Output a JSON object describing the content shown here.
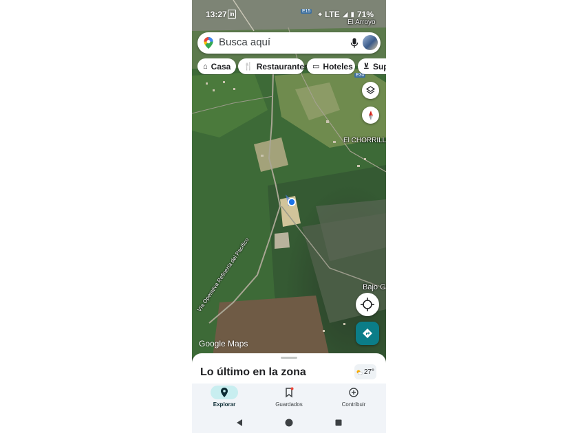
{
  "status": {
    "time": "13:27",
    "app_icon": "in",
    "network": "LTE",
    "battery": "71%"
  },
  "map_labels": {
    "el_arroyo": "El Arroyo",
    "el_chorrillo": "El CHORRILLO",
    "bajo": "Bajo G",
    "road": "Vía Operativa Refinería del Pacífico",
    "highway": "E15",
    "highway2": "E30"
  },
  "search": {
    "placeholder": "Busca aquí"
  },
  "chips": [
    {
      "icon": "home-icon",
      "label": "Casa"
    },
    {
      "icon": "restaurant-icon",
      "label": "Restaurantes"
    },
    {
      "icon": "hotel-icon",
      "label": "Hoteles"
    },
    {
      "icon": "cart-icon",
      "label": "Supe"
    }
  ],
  "brand": {
    "logo": "Google Maps"
  },
  "sheet": {
    "title": "Lo último en la zona",
    "temperature": "27°"
  },
  "nav": [
    {
      "icon": "explore-pin-icon",
      "label": "Explorar",
      "active": true
    },
    {
      "icon": "bookmark-icon",
      "label": "Guardados",
      "active": false
    },
    {
      "icon": "add-circle-icon",
      "label": "Contribuir",
      "active": false
    }
  ],
  "colors": {
    "accent": "#0b7d88",
    "active_pill": "#c8eef0",
    "location_dot": "#1a73e8"
  }
}
